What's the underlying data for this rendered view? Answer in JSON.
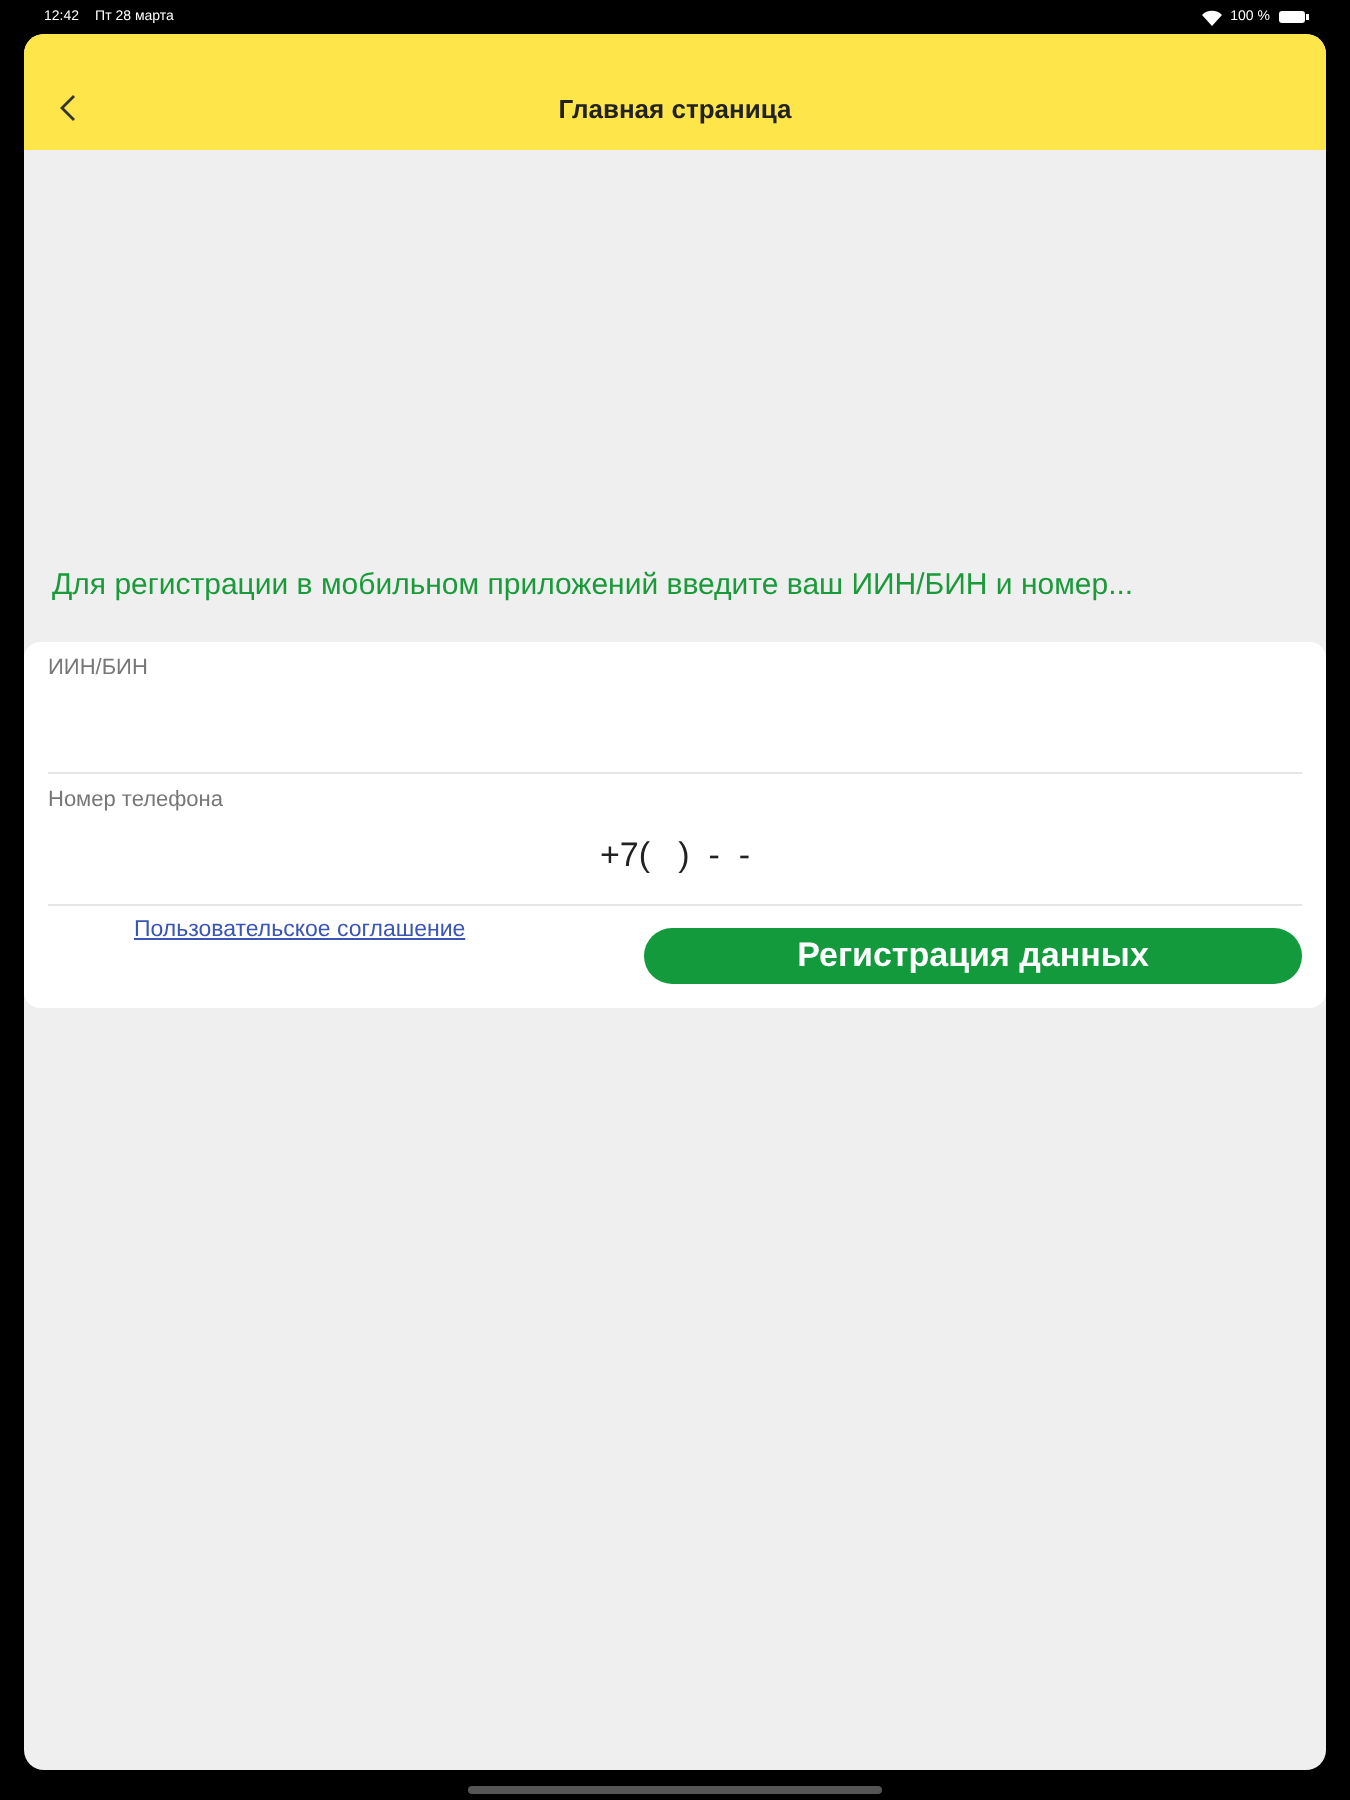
{
  "status_bar": {
    "time": "12:42",
    "date": "Пт 28 марта",
    "battery": "100 %"
  },
  "header": {
    "title": "Главная страница"
  },
  "intro": "Для регистрации в мобильном приложений введите ваш ИИН/БИН и номер...",
  "form": {
    "fields": [
      {
        "label": "ИИН/БИН"
      },
      {
        "label": "Номер телефона",
        "value": "+7(   )  -  -"
      }
    ],
    "agreement_link": "Пользовательское соглашение",
    "submit_button": "Регистрация данных"
  }
}
